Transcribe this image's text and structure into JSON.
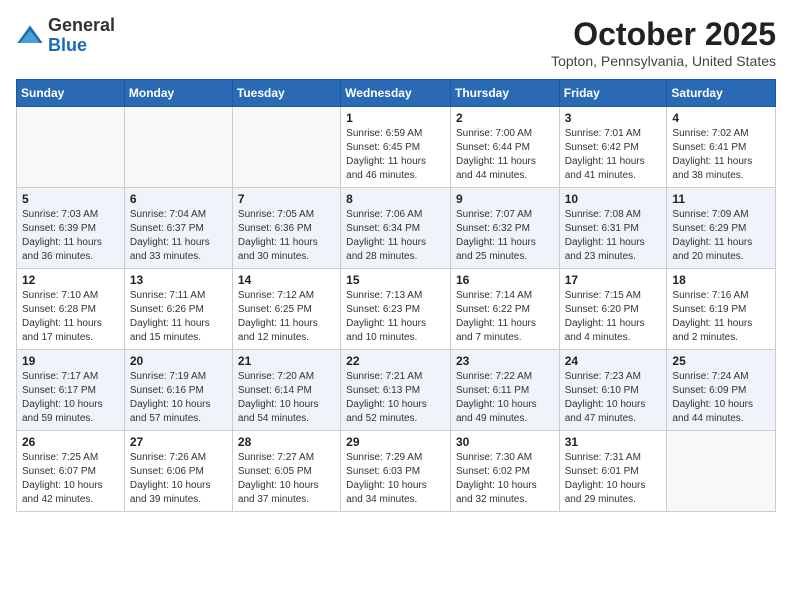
{
  "logo": {
    "general": "General",
    "blue": "Blue"
  },
  "title": "October 2025",
  "location": "Topton, Pennsylvania, United States",
  "days_of_week": [
    "Sunday",
    "Monday",
    "Tuesday",
    "Wednesday",
    "Thursday",
    "Friday",
    "Saturday"
  ],
  "weeks": [
    [
      {
        "day": "",
        "info": ""
      },
      {
        "day": "",
        "info": ""
      },
      {
        "day": "",
        "info": ""
      },
      {
        "day": "1",
        "info": "Sunrise: 6:59 AM\nSunset: 6:45 PM\nDaylight: 11 hours and 46 minutes."
      },
      {
        "day": "2",
        "info": "Sunrise: 7:00 AM\nSunset: 6:44 PM\nDaylight: 11 hours and 44 minutes."
      },
      {
        "day": "3",
        "info": "Sunrise: 7:01 AM\nSunset: 6:42 PM\nDaylight: 11 hours and 41 minutes."
      },
      {
        "day": "4",
        "info": "Sunrise: 7:02 AM\nSunset: 6:41 PM\nDaylight: 11 hours and 38 minutes."
      }
    ],
    [
      {
        "day": "5",
        "info": "Sunrise: 7:03 AM\nSunset: 6:39 PM\nDaylight: 11 hours and 36 minutes."
      },
      {
        "day": "6",
        "info": "Sunrise: 7:04 AM\nSunset: 6:37 PM\nDaylight: 11 hours and 33 minutes."
      },
      {
        "day": "7",
        "info": "Sunrise: 7:05 AM\nSunset: 6:36 PM\nDaylight: 11 hours and 30 minutes."
      },
      {
        "day": "8",
        "info": "Sunrise: 7:06 AM\nSunset: 6:34 PM\nDaylight: 11 hours and 28 minutes."
      },
      {
        "day": "9",
        "info": "Sunrise: 7:07 AM\nSunset: 6:32 PM\nDaylight: 11 hours and 25 minutes."
      },
      {
        "day": "10",
        "info": "Sunrise: 7:08 AM\nSunset: 6:31 PM\nDaylight: 11 hours and 23 minutes."
      },
      {
        "day": "11",
        "info": "Sunrise: 7:09 AM\nSunset: 6:29 PM\nDaylight: 11 hours and 20 minutes."
      }
    ],
    [
      {
        "day": "12",
        "info": "Sunrise: 7:10 AM\nSunset: 6:28 PM\nDaylight: 11 hours and 17 minutes."
      },
      {
        "day": "13",
        "info": "Sunrise: 7:11 AM\nSunset: 6:26 PM\nDaylight: 11 hours and 15 minutes."
      },
      {
        "day": "14",
        "info": "Sunrise: 7:12 AM\nSunset: 6:25 PM\nDaylight: 11 hours and 12 minutes."
      },
      {
        "day": "15",
        "info": "Sunrise: 7:13 AM\nSunset: 6:23 PM\nDaylight: 11 hours and 10 minutes."
      },
      {
        "day": "16",
        "info": "Sunrise: 7:14 AM\nSunset: 6:22 PM\nDaylight: 11 hours and 7 minutes."
      },
      {
        "day": "17",
        "info": "Sunrise: 7:15 AM\nSunset: 6:20 PM\nDaylight: 11 hours and 4 minutes."
      },
      {
        "day": "18",
        "info": "Sunrise: 7:16 AM\nSunset: 6:19 PM\nDaylight: 11 hours and 2 minutes."
      }
    ],
    [
      {
        "day": "19",
        "info": "Sunrise: 7:17 AM\nSunset: 6:17 PM\nDaylight: 10 hours and 59 minutes."
      },
      {
        "day": "20",
        "info": "Sunrise: 7:19 AM\nSunset: 6:16 PM\nDaylight: 10 hours and 57 minutes."
      },
      {
        "day": "21",
        "info": "Sunrise: 7:20 AM\nSunset: 6:14 PM\nDaylight: 10 hours and 54 minutes."
      },
      {
        "day": "22",
        "info": "Sunrise: 7:21 AM\nSunset: 6:13 PM\nDaylight: 10 hours and 52 minutes."
      },
      {
        "day": "23",
        "info": "Sunrise: 7:22 AM\nSunset: 6:11 PM\nDaylight: 10 hours and 49 minutes."
      },
      {
        "day": "24",
        "info": "Sunrise: 7:23 AM\nSunset: 6:10 PM\nDaylight: 10 hours and 47 minutes."
      },
      {
        "day": "25",
        "info": "Sunrise: 7:24 AM\nSunset: 6:09 PM\nDaylight: 10 hours and 44 minutes."
      }
    ],
    [
      {
        "day": "26",
        "info": "Sunrise: 7:25 AM\nSunset: 6:07 PM\nDaylight: 10 hours and 42 minutes."
      },
      {
        "day": "27",
        "info": "Sunrise: 7:26 AM\nSunset: 6:06 PM\nDaylight: 10 hours and 39 minutes."
      },
      {
        "day": "28",
        "info": "Sunrise: 7:27 AM\nSunset: 6:05 PM\nDaylight: 10 hours and 37 minutes."
      },
      {
        "day": "29",
        "info": "Sunrise: 7:29 AM\nSunset: 6:03 PM\nDaylight: 10 hours and 34 minutes."
      },
      {
        "day": "30",
        "info": "Sunrise: 7:30 AM\nSunset: 6:02 PM\nDaylight: 10 hours and 32 minutes."
      },
      {
        "day": "31",
        "info": "Sunrise: 7:31 AM\nSunset: 6:01 PM\nDaylight: 10 hours and 29 minutes."
      },
      {
        "day": "",
        "info": ""
      }
    ]
  ]
}
